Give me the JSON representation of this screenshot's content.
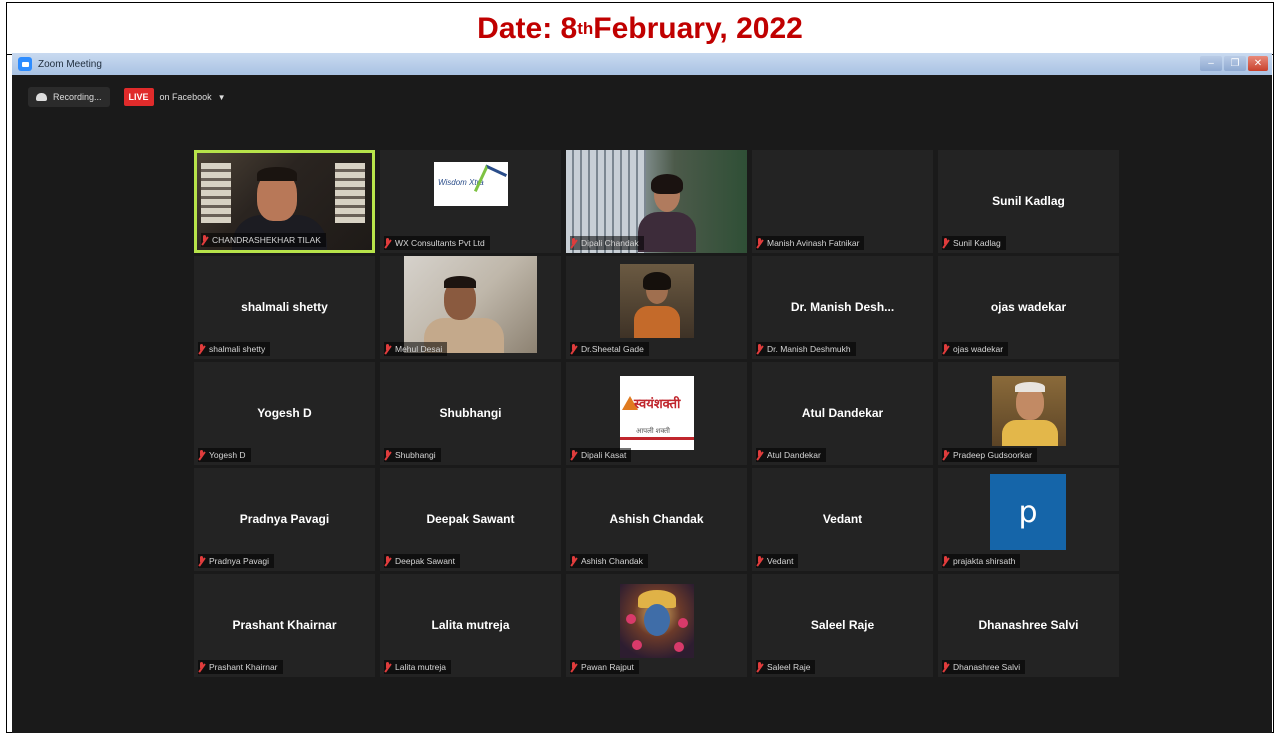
{
  "banner": {
    "prefix": "Date: 8",
    "superscript": "th",
    "suffix": " February, 2022"
  },
  "window": {
    "title": "Zoom Meeting",
    "controls": [
      "minimize",
      "maximize",
      "close"
    ]
  },
  "toolbar": {
    "recording_label": "Recording...",
    "live_badge": "LIVE",
    "live_destination": "on Facebook"
  },
  "participants": [
    {
      "label": "CHANDRASHEKHAR TILAK",
      "display_name": "",
      "video": "chandra",
      "active_speaker": true
    },
    {
      "label": "WX Consultants Pvt Ltd",
      "display_name": "",
      "video": "wx"
    },
    {
      "label": "Dipali Chandak",
      "display_name": "",
      "video": "dipali-chandak"
    },
    {
      "label": "Manish Avinash Fatnikar",
      "display_name": ""
    },
    {
      "label": "Sunil Kadlag",
      "display_name": "Sunil Kadlag"
    },
    {
      "label": "shalmali shetty",
      "display_name": "shalmali shetty"
    },
    {
      "label": "Mehul Desai",
      "display_name": "",
      "video": "mehul"
    },
    {
      "label": "Dr.Sheetal Gade",
      "display_name": "",
      "video": "sheetal"
    },
    {
      "label": "Dr. Manish Deshmukh",
      "display_name": "Dr. Manish Desh..."
    },
    {
      "label": "ojas wadekar",
      "display_name": "ojas wadekar"
    },
    {
      "label": "Yogesh D",
      "display_name": "Yogesh D"
    },
    {
      "label": "Shubhangi",
      "display_name": "Shubhangi"
    },
    {
      "label": "Dipali Kasat",
      "display_name": "",
      "video": "swayam"
    },
    {
      "label": "Atul Dandekar",
      "display_name": "Atul Dandekar"
    },
    {
      "label": "Pradeep Gudsoorkar",
      "display_name": "",
      "video": "pradeep"
    },
    {
      "label": "Pradnya Pavagi",
      "display_name": "Pradnya Pavagi"
    },
    {
      "label": "Deepak Sawant",
      "display_name": "Deepak Sawant"
    },
    {
      "label": "Ashish Chandak",
      "display_name": "Ashish Chandak"
    },
    {
      "label": "Vedant",
      "display_name": "Vedant"
    },
    {
      "label": "prajakta shirsath",
      "display_name": "",
      "video": "prajakta",
      "avatar_letter": "p"
    },
    {
      "label": "Prashant Khairnar",
      "display_name": "Prashant Khairnar"
    },
    {
      "label": "Lalita mutreja",
      "display_name": "Lalita mutreja"
    },
    {
      "label": "Pawan Rajput",
      "display_name": "",
      "video": "pawan"
    },
    {
      "label": "Saleel Raje",
      "display_name": "Saleel Raje"
    },
    {
      "label": "Dhanashree Salvi",
      "display_name": "Dhanashree Salvi"
    }
  ],
  "wx_logo_text": "Wisdom Xtra",
  "swayam_logo_text": "स्वयंशक्ती",
  "swayam_sub_text": "आपली शक्ती",
  "colors": {
    "banner_text": "#c00000",
    "active_speaker_border": "#b7e34a",
    "live_badge": "#e02b2b",
    "tile_background": "#232323",
    "window_background": "#1a1a1a"
  },
  "icons": [
    "zoom-logo-icon",
    "cloud-recording-icon",
    "chevron-down-icon",
    "muted-mic-icon"
  ]
}
